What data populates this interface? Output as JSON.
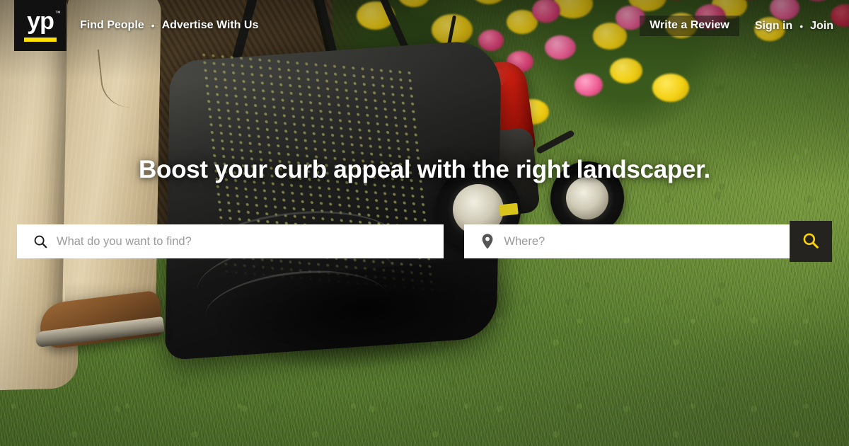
{
  "brand": {
    "logo_text": "yp",
    "logo_tm": "™",
    "logo_bar_color": "#ffe000",
    "logo_bg_color": "#111111"
  },
  "header": {
    "left_links": [
      {
        "label": "Find People",
        "name": "find-people"
      },
      {
        "label": "Advertise With Us",
        "name": "advertise-with-us"
      }
    ],
    "separator": "•",
    "write_review_label": "Write a Review",
    "right_links": [
      {
        "label": "Sign in",
        "name": "sign-in"
      },
      {
        "label": "Join",
        "name": "join"
      }
    ]
  },
  "hero": {
    "headline": "Boost your curb appeal with the right landscaper."
  },
  "search": {
    "what_placeholder": "What do you want to find?",
    "what_value": "",
    "where_placeholder": "Where?",
    "where_value": "",
    "what_icon": "search-icon",
    "where_icon": "location-pin-icon",
    "submit_icon": "search-icon",
    "submit_bg_color": "#242320",
    "submit_icon_color": "#ffd400"
  },
  "theme": {
    "accent_yellow": "#ffe000",
    "text_white": "#ffffff",
    "placeholder_gray": "#9a9a9a",
    "dark": "#242320"
  },
  "background": {
    "description": "photo-lawn-mower-flowers",
    "grass_green": "#5d7d35",
    "flower_yellow": "#f2cf13",
    "flower_pink": "#e0447a",
    "mower_red": "#e02212",
    "pants_khaki": "#d6c49f"
  }
}
